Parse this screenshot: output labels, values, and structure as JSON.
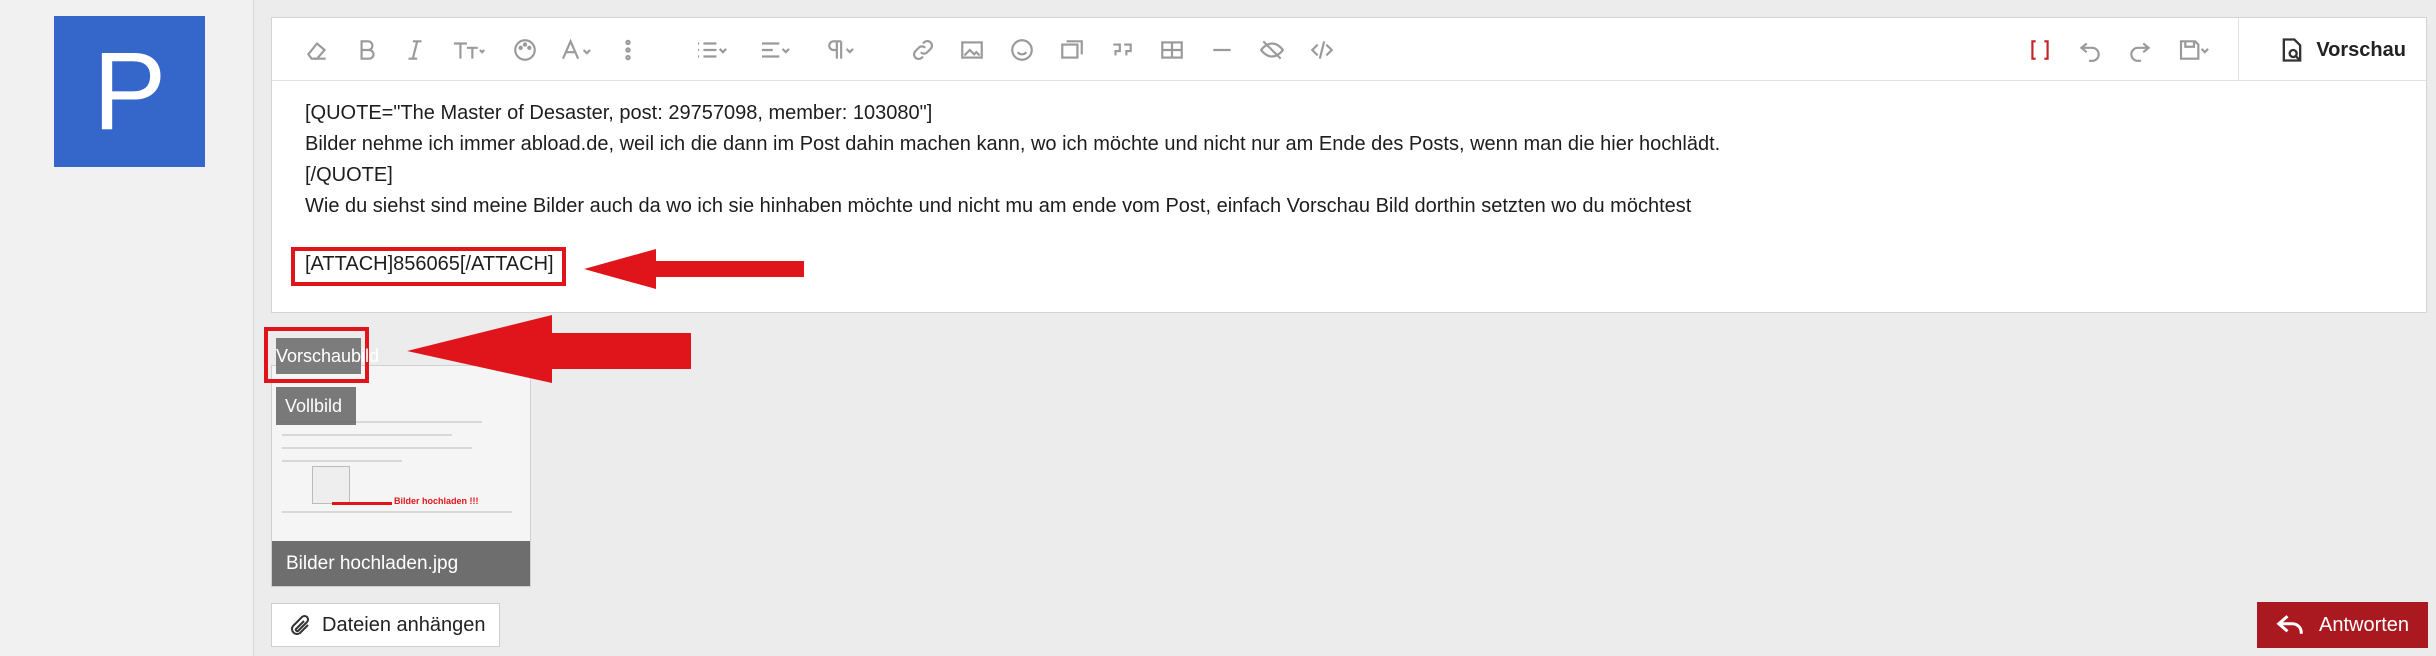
{
  "user": {
    "avatar_letter": "P",
    "avatar_color": "#3566c9"
  },
  "toolbar": {
    "icons": [
      "eraser-icon",
      "bold-icon",
      "italic-icon",
      "text-size-icon",
      "palette-icon",
      "font-icon",
      "more-vertical-icon",
      "list-icon",
      "align-icon",
      "paragraph-icon",
      "link-icon",
      "image-icon",
      "smile-icon",
      "media-icon",
      "quote-icon",
      "table-icon",
      "horizontal-rule-icon",
      "spoiler-icon",
      "code-icon",
      "bbcode-toggle-icon",
      "undo-icon",
      "redo-icon",
      "save-draft-icon"
    ],
    "preview_label": "Vorschau"
  },
  "editor": {
    "lines": [
      "[QUOTE=\"The Master of Desaster, post: 29757098, member: 103080\"]",
      "Bilder nehme ich immer abload.de, weil ich die dann im Post dahin machen kann, wo ich möchte und nicht nur am Ende des Posts, wenn man die hier hochlädt.",
      "[/QUOTE]",
      "Wie du siehst sind meine Bilder auch da wo ich sie hinhaben möchte und nicht mu am ende vom Post, einfach Vorschau Bild dorthin setzten wo du möchtest"
    ],
    "attach_line": "[ATTACH]856065[/ATTACH]"
  },
  "attachment": {
    "vorschau_label": "Vorschaubild",
    "vollbild_label": "Vollbild",
    "filename": "Bilder hochladen.jpg",
    "thumb_text": "Bilder hochladen !!!"
  },
  "footer": {
    "attach_button": "Dateien anhängen",
    "reply_button": "Antworten"
  },
  "colors": {
    "annotation_red": "#e0151c",
    "reply_red": "#a9191f"
  }
}
